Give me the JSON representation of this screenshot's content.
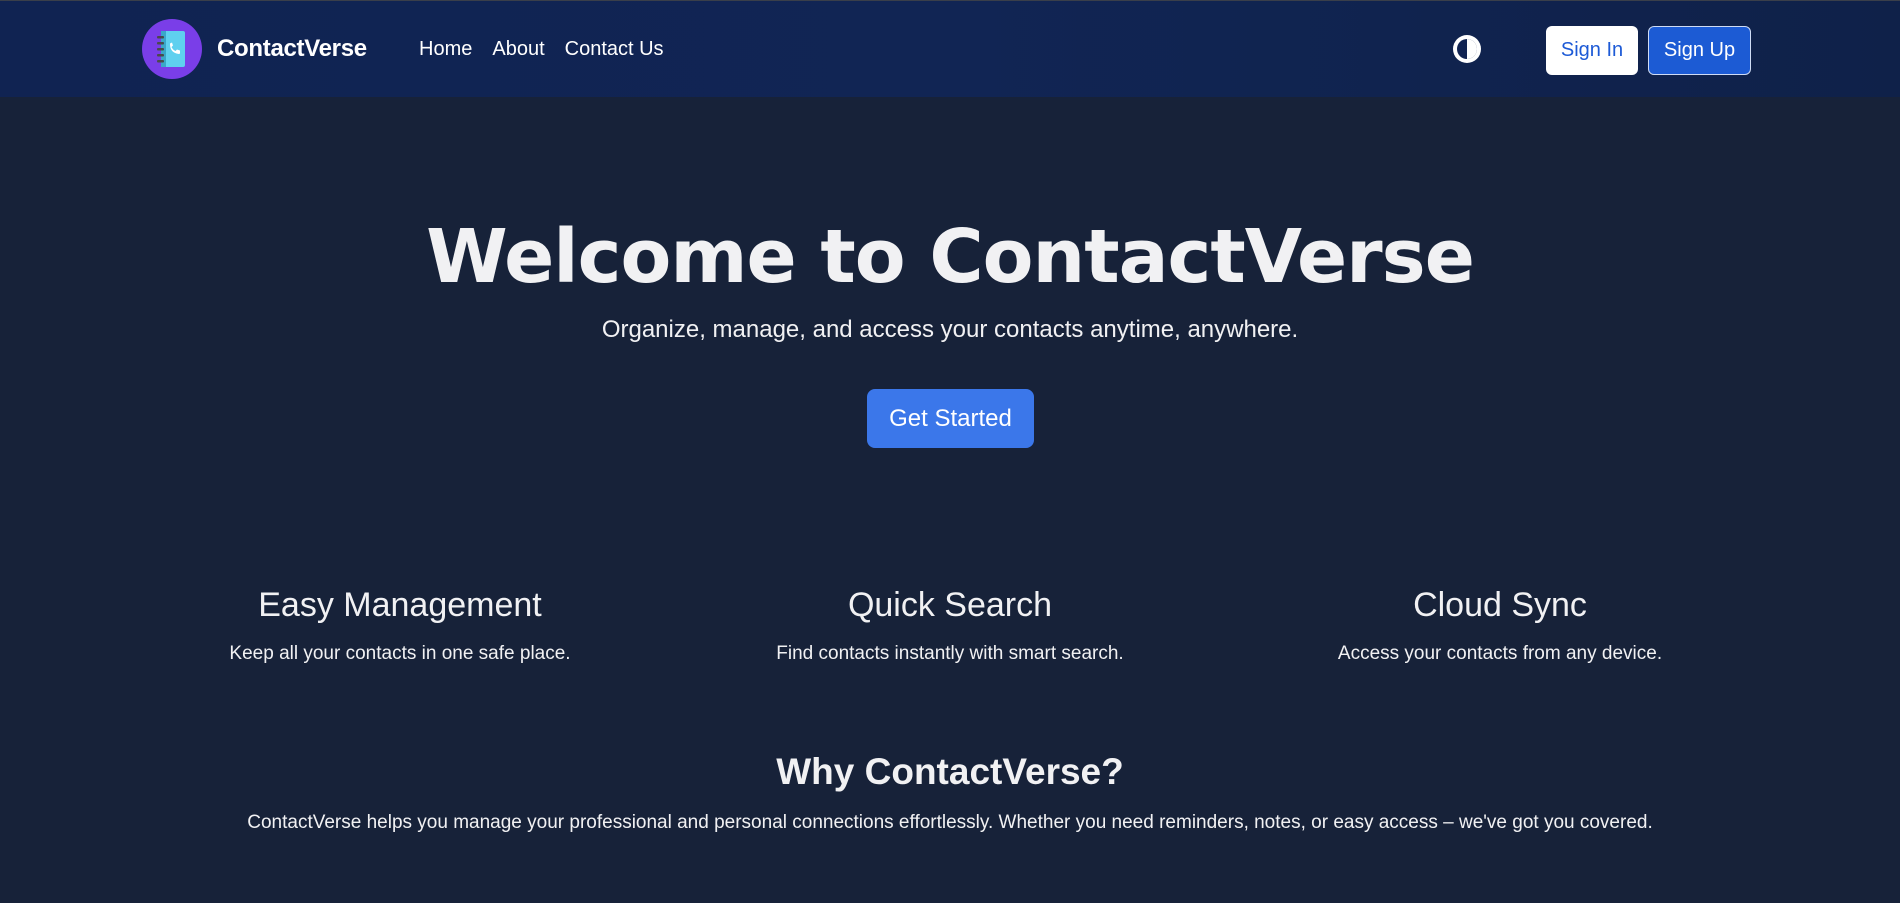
{
  "brand": {
    "name": "ContactVerse",
    "logo_icon": "contact-book-phone-icon",
    "logo_color": "#7a3ee8"
  },
  "nav": {
    "links": [
      "Home",
      "About",
      "Contact Us"
    ],
    "theme_toggle_icon": "contrast-half-circle-icon",
    "signin_label": "Sign In",
    "signup_label": "Sign Up"
  },
  "hero": {
    "title": "Welcome to ContactVerse",
    "subtitle": "Organize, manage, and access your contacts anytime, anywhere.",
    "cta_label": "Get Started"
  },
  "features": [
    {
      "title": "Easy Management",
      "text": "Keep all your contacts in one safe place."
    },
    {
      "title": "Quick Search",
      "text": "Find contacts instantly with smart search."
    },
    {
      "title": "Cloud Sync",
      "text": "Access your contacts from any device."
    }
  ],
  "why": {
    "title": "Why ContactVerse?",
    "text": "ContactVerse helps you manage your professional and personal connections effortlessly. Whether you need reminders, notes, or easy access – we've got you covered."
  },
  "colors": {
    "background": "#172239",
    "navbar": "#102352",
    "accent": "#3b77ea",
    "signup": "#1c5bd4"
  }
}
